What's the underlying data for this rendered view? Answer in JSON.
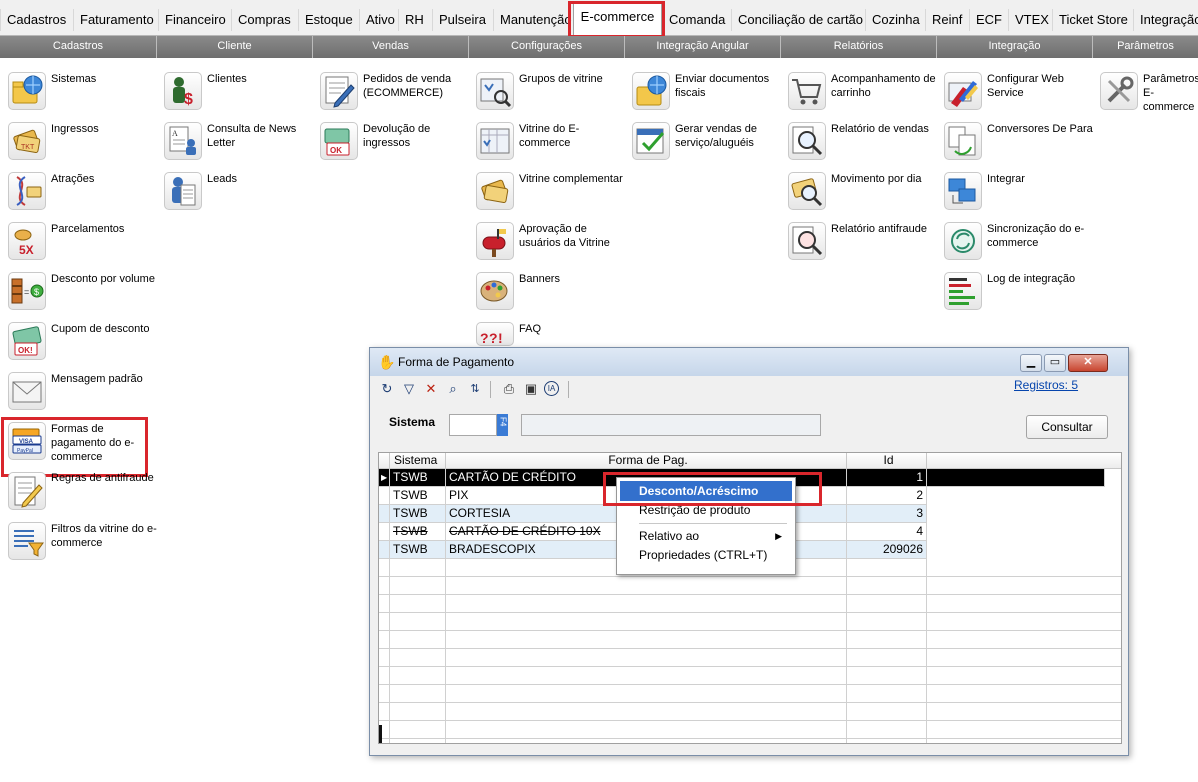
{
  "tabs": [
    "Cadastros",
    "Faturamento",
    "Financeiro",
    "Compras",
    "Estoque",
    "Ativo",
    "RH",
    "Pulseira",
    "Manutenção",
    "E-commerce",
    "Comanda",
    "Conciliação de cartão",
    "Cozinha",
    "Reinf",
    "ECF",
    "VTEX",
    "Ticket Store",
    "Integração"
  ],
  "active_tab": "E-commerce",
  "categories": [
    "Cadastros",
    "Cliente",
    "Vendas",
    "Configurações",
    "Integração Angular",
    "Relatórios",
    "Integração",
    "Parâmetros"
  ],
  "columns": {
    "cadastros": [
      {
        "label": "Sistemas",
        "icon": "folder-globe-icon"
      },
      {
        "label": "Ingressos",
        "icon": "tickets-icon"
      },
      {
        "label": "Atrações",
        "icon": "dna-tickets-icon"
      },
      {
        "label": "Parcelamentos",
        "icon": "installments-5x-icon"
      },
      {
        "label": "Desconto por volume",
        "icon": "volume-discount-icon"
      },
      {
        "label": "Cupom de desconto",
        "icon": "coupon-ok-icon"
      },
      {
        "label": "Mensagem padrão",
        "icon": "envelope-icon"
      },
      {
        "label": "Formas de pagamento do e-commerce",
        "icon": "credit-cards-icon"
      },
      {
        "label": "Regras de antifraude",
        "icon": "checklist-pencil-icon"
      },
      {
        "label": "Filtros da vitrine do e-commerce",
        "icon": "filter-list-icon"
      }
    ],
    "cliente": [
      {
        "label": "Clientes",
        "icon": "client-money-icon"
      },
      {
        "label": "Consulta de News Letter",
        "icon": "newsletter-icon"
      },
      {
        "label": "Leads",
        "icon": "leads-icon"
      }
    ],
    "vendas": [
      {
        "label": "Pedidos de venda (ECOMMERCE)",
        "icon": "order-pencil-icon"
      },
      {
        "label": "Devolução de ingressos",
        "icon": "return-tickets-icon"
      }
    ],
    "configuracoes": [
      {
        "label": "Grupos de vitrine",
        "icon": "showcase-group-icon"
      },
      {
        "label": "Vitrine do E-commerce",
        "icon": "showcase-icon"
      },
      {
        "label": "Vitrine complementar",
        "icon": "complementary-tickets-icon"
      },
      {
        "label": "Aprovação de usuários da Vitrine",
        "icon": "mailbox-icon"
      },
      {
        "label": "Banners",
        "icon": "palette-icon"
      },
      {
        "label": "FAQ",
        "icon": "faq-icon"
      }
    ],
    "integracao_angular": [
      {
        "label": "Enviar documentos fiscais",
        "icon": "folder-globe-send-icon"
      },
      {
        "label": "Gerar vendas de serviço/aluguéis",
        "icon": "calendar-check-icon"
      }
    ],
    "relatorios": [
      {
        "label": "Acompanhamento de carrinho",
        "icon": "cart-icon"
      },
      {
        "label": "Relatório de vendas",
        "icon": "report-magnifier-icon"
      },
      {
        "label": "Movimento por dia",
        "icon": "tickets-magnifier-icon"
      },
      {
        "label": "Relatório antifraude",
        "icon": "antifraud-report-icon"
      }
    ],
    "integracao": [
      {
        "label": "Configurar Web Service",
        "icon": "web-service-icon"
      },
      {
        "label": "Conversores De Para",
        "icon": "converter-icon"
      },
      {
        "label": "Integrar",
        "icon": "computers-icon"
      },
      {
        "label": "Sincronização do e-commerce",
        "icon": "sync-icon"
      },
      {
        "label": "Log de integração",
        "icon": "log-bars-icon"
      }
    ],
    "parametros": [
      {
        "label": "Parâmetros E-commerce",
        "icon": "tools-icon"
      }
    ]
  },
  "dialog": {
    "title": "Forma de Pagamento",
    "registros": "Registros: 5",
    "sistema_label": "Sistema",
    "sistema_value": "",
    "f4_label": "F4",
    "consultar_label": "Consultar",
    "window_buttons": {
      "minimize": "▁",
      "maximize": "▭",
      "close": "✕"
    },
    "toolbar_icons": [
      "refresh-icon",
      "filter-icon",
      "clear-filter-icon",
      "search-icon",
      "sort-icon",
      "print-icon",
      "save-icon",
      "ia-icon"
    ],
    "grid": {
      "headers": [
        "Sistema",
        "Forma de Pag.",
        "Id"
      ],
      "rows": [
        {
          "sistema": "TSWB",
          "forma": "CARTÃO DE CRÉDITO",
          "id": "1",
          "state": "selected"
        },
        {
          "sistema": "TSWB",
          "forma": "PIX",
          "id": "2",
          "state": "normal"
        },
        {
          "sistema": "TSWB",
          "forma": "CORTESIA",
          "id": "3",
          "state": "alt"
        },
        {
          "sistema": "TSWB",
          "forma": "CARTÃO DE CRÉDITO 10X",
          "id": "4",
          "state": "strike"
        },
        {
          "sistema": "TSWB",
          "forma": "BRADESCOPIX",
          "id": "209026",
          "state": "alt"
        }
      ]
    }
  },
  "context_menu": {
    "items": [
      "Desconto/Acréscimo",
      "Restrição de produto",
      "Relativo ao",
      "Propriedades (CTRL+T)"
    ],
    "highlighted": "Desconto/Acréscimo"
  },
  "colors": {
    "highlight_red": "#d9262c",
    "menu_highlight": "#3370cc",
    "link": "#0645ad"
  }
}
